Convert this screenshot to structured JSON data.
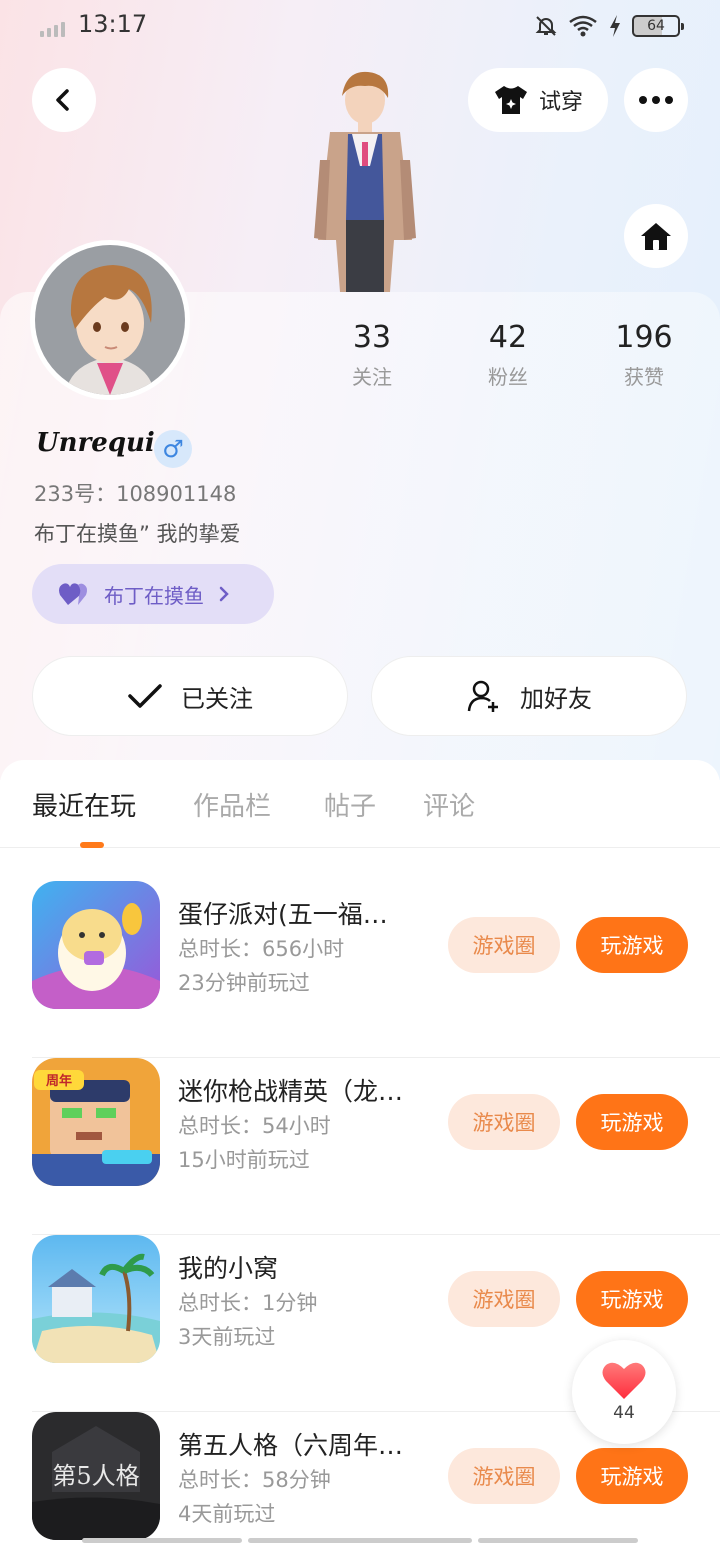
{
  "status_bar": {
    "time": "13:17",
    "battery": "64"
  },
  "header": {
    "try_on_label": "试穿"
  },
  "stats": [
    {
      "value": "33",
      "label": "关注"
    },
    {
      "value": "42",
      "label": "粉丝"
    },
    {
      "value": "196",
      "label": "获赞"
    }
  ],
  "profile": {
    "username": "Unrequi",
    "gender_symbol": "♂",
    "uid_text": "233号：108901148",
    "bio": "布丁在摸鱼” 我的挚爱",
    "club_label": "布丁在摸鱼"
  },
  "actions": {
    "followed_label": "已关注",
    "add_friend_label": "加好友"
  },
  "tabs": [
    {
      "label": "最近在玩"
    },
    {
      "label": "作品栏"
    },
    {
      "label": "帖子"
    },
    {
      "label": "评论"
    }
  ],
  "games": [
    {
      "title": "蛋仔派对(五一福…",
      "playtime": "总时长：656小时",
      "last_played": "23分钟前玩过",
      "circle_label": "游戏圈",
      "play_label": "玩游戏"
    },
    {
      "title": "迷你枪战精英（龙…",
      "playtime": "总时长：54小时",
      "last_played": "15小时前玩过",
      "circle_label": "游戏圈",
      "play_label": "玩游戏",
      "icon_badge": "周年"
    },
    {
      "title": "我的小窝",
      "playtime": "总时长：1分钟",
      "last_played": "3天前玩过",
      "circle_label": "游戏圈",
      "play_label": "玩游戏"
    },
    {
      "title": "第五人格（六周年…",
      "playtime": "总时长：58分钟",
      "last_played": "4天前玩过",
      "circle_label": "游戏圈",
      "play_label": "玩游戏",
      "icon_text": "第5人格"
    }
  ],
  "like_float": {
    "count": "44"
  },
  "colors": {
    "accent": "#ff7417",
    "accent_soft": "#fde8dc",
    "club_purple": "#6e5dc6"
  }
}
